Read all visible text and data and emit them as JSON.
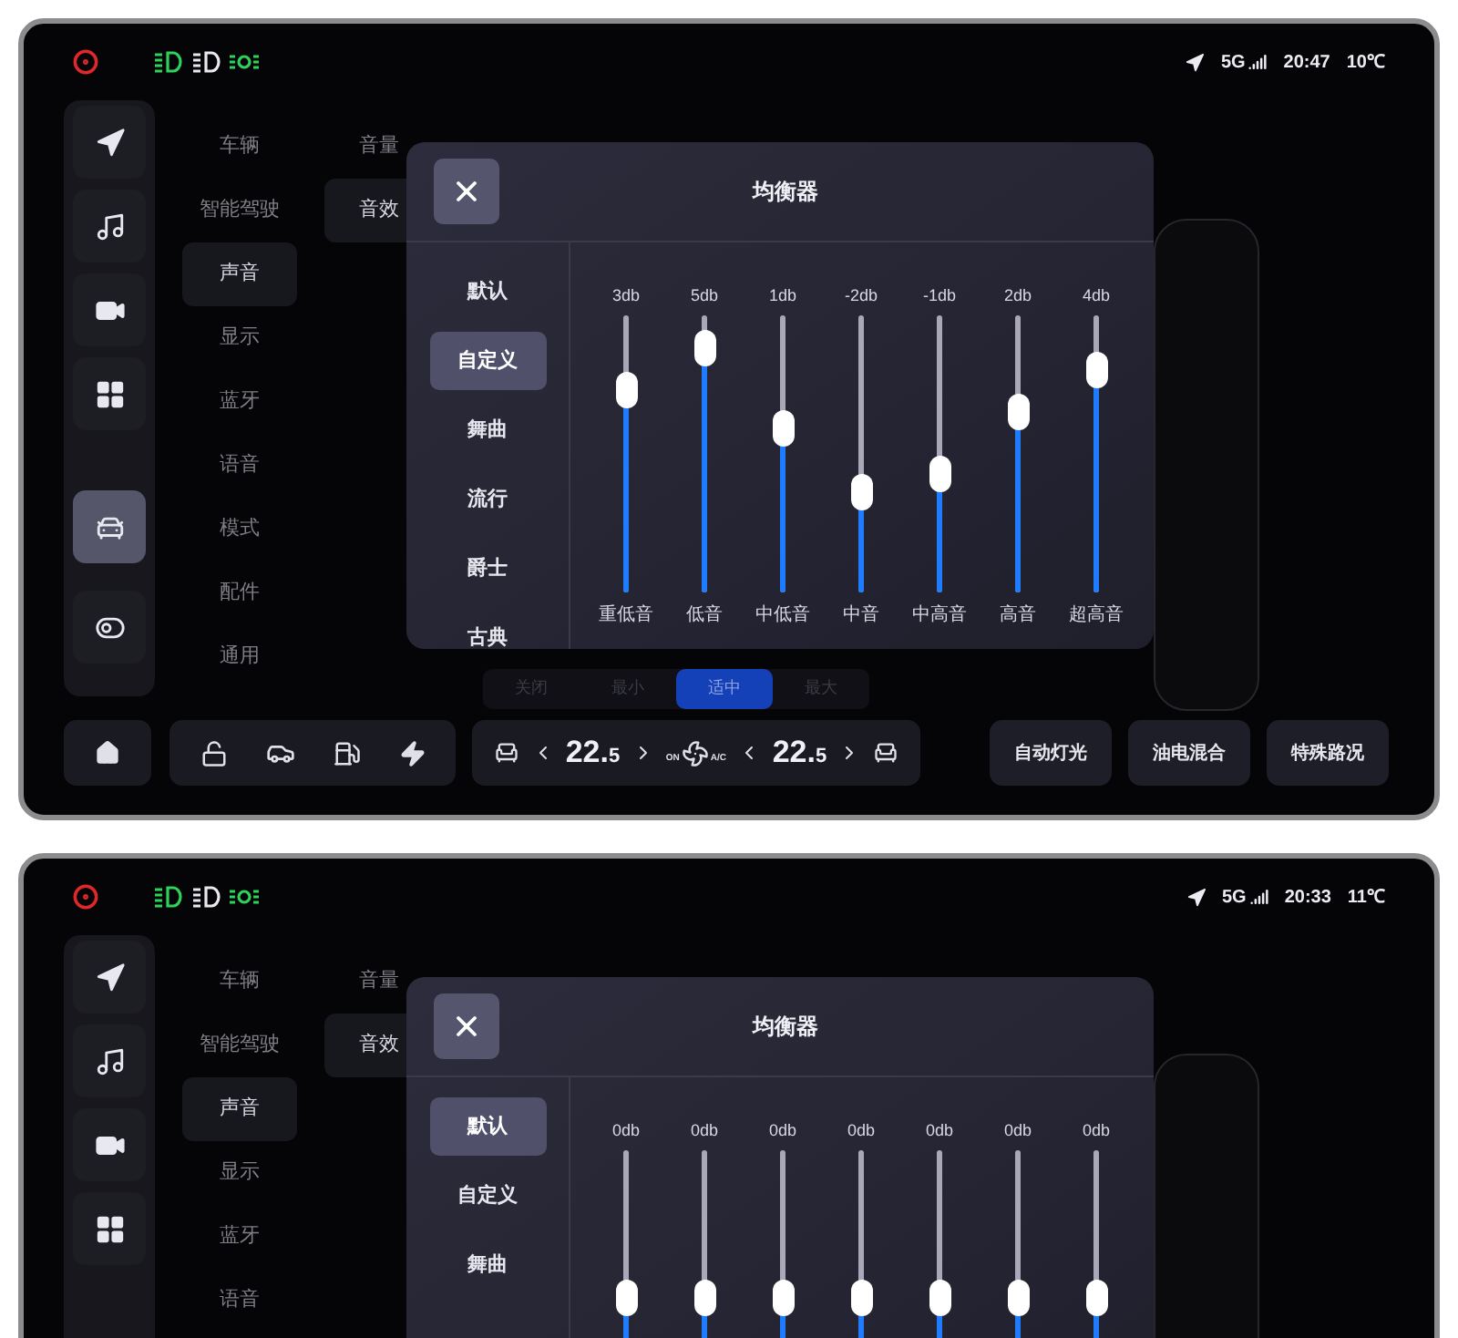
{
  "screens": [
    {
      "status_bar": {
        "network": "5G",
        "time": "20:47",
        "temperature": "10℃"
      },
      "nav_rail": [
        {
          "selected": false
        },
        {
          "selected": false
        },
        {
          "selected": false
        },
        {
          "selected": false
        },
        {
          "selected": true
        },
        {
          "selected": false
        }
      ],
      "menu": [
        {
          "label": "车辆",
          "selected": false
        },
        {
          "label": "智能驾驶",
          "selected": false
        },
        {
          "label": "声音",
          "selected": true
        },
        {
          "label": "显示",
          "selected": false
        },
        {
          "label": "蓝牙",
          "selected": false
        },
        {
          "label": "语音",
          "selected": false
        },
        {
          "label": "模式",
          "selected": false
        },
        {
          "label": "配件",
          "selected": false
        },
        {
          "label": "通用",
          "selected": false
        }
      ],
      "submenu": [
        {
          "label": "音量",
          "selected": false
        },
        {
          "label": "音效",
          "selected": true
        }
      ],
      "volume_mode": [
        {
          "label": "关闭",
          "selected": false
        },
        {
          "label": "最小",
          "selected": false
        },
        {
          "label": "适中",
          "selected": true
        },
        {
          "label": "最大",
          "selected": false
        }
      ],
      "equalizer": {
        "title": "均衡器",
        "presets": [
          {
            "label": "默认",
            "selected": false
          },
          {
            "label": "自定义",
            "selected": true
          },
          {
            "label": "舞曲",
            "selected": false
          },
          {
            "label": "流行",
            "selected": false
          },
          {
            "label": "爵士",
            "selected": false
          },
          {
            "label": "古典",
            "selected": false
          }
        ],
        "bands": [
          {
            "value": "3db",
            "name": "重低音",
            "level": 0.73
          },
          {
            "value": "5db",
            "name": "低音",
            "level": 0.88
          },
          {
            "value": "1db",
            "name": "中低音",
            "level": 0.59
          },
          {
            "value": "-2db",
            "name": "中音",
            "level": 0.36
          },
          {
            "value": "-1db",
            "name": "中高音",
            "level": 0.43
          },
          {
            "value": "2db",
            "name": "高音",
            "level": 0.65
          },
          {
            "value": "4db",
            "name": "超高音",
            "level": 0.8
          }
        ]
      },
      "bottom_bar": {
        "left_temperature": "22.5",
        "right_temperature": "22.5",
        "fan_on": "ON",
        "fan_ac": "A/C",
        "buttons": [
          "自动灯光",
          "油电混合",
          "特殊路况"
        ]
      }
    },
    {
      "status_bar": {
        "network": "5G",
        "time": "20:33",
        "temperature": "11℃"
      },
      "nav_rail": [
        {
          "selected": false
        },
        {
          "selected": false
        },
        {
          "selected": false
        },
        {
          "selected": false
        }
      ],
      "menu": [
        {
          "label": "车辆",
          "selected": false
        },
        {
          "label": "智能驾驶",
          "selected": false
        },
        {
          "label": "声音",
          "selected": true
        },
        {
          "label": "显示",
          "selected": false
        },
        {
          "label": "蓝牙",
          "selected": false
        },
        {
          "label": "语音",
          "selected": false
        }
      ],
      "submenu": [
        {
          "label": "音量",
          "selected": false
        },
        {
          "label": "音效",
          "selected": true
        }
      ],
      "equalizer": {
        "title": "均衡器",
        "presets": [
          {
            "label": "默认",
            "selected": true
          },
          {
            "label": "自定义",
            "selected": false
          },
          {
            "label": "舞曲",
            "selected": false
          }
        ],
        "bands": [
          {
            "value": "0db",
            "level": 0.47
          },
          {
            "value": "0db",
            "level": 0.47
          },
          {
            "value": "0db",
            "level": 0.47
          },
          {
            "value": "0db",
            "level": 0.47
          },
          {
            "value": "0db",
            "level": 0.47
          },
          {
            "value": "0db",
            "level": 0.47
          },
          {
            "value": "0db",
            "level": 0.47
          }
        ]
      }
    }
  ]
}
